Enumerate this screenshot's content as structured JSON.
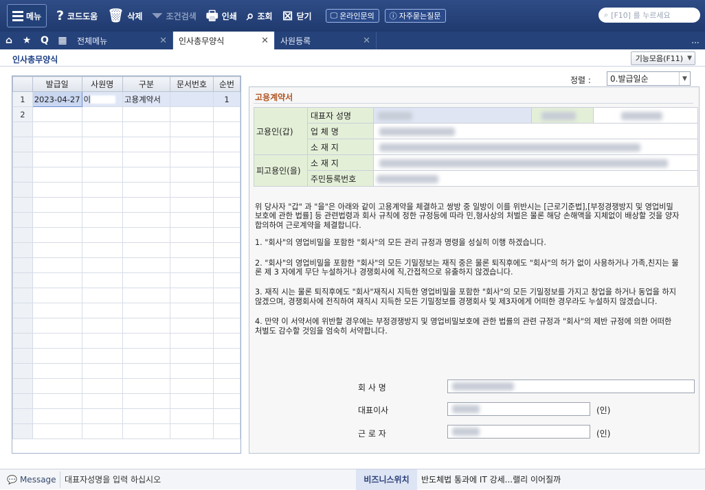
{
  "toolbar": {
    "menu_label": "메뉴",
    "code_help": "코드도움",
    "delete": "삭제",
    "condition_search": "조건검색",
    "print": "인쇄",
    "view": "조회",
    "close": "닫기",
    "online_inquiry": "온라인문의",
    "faq": "자주묻는질문",
    "search_placeholder": "[F10] 를 누르세요"
  },
  "tabs": {
    "all_menu": "전체메뉴",
    "hr_forms": "인사총무양식",
    "employee_reg": "사원등록",
    "more": "..."
  },
  "page": {
    "title": "인사총무양식",
    "func_button": "기능모음(F11)"
  },
  "grid": {
    "columns": [
      "발급일",
      "사원명",
      "구분",
      "문서번호",
      "순번"
    ],
    "rows": [
      {
        "num": "1",
        "date": "2023-04-27",
        "name": "이",
        "type": "고용계약서",
        "doc": "",
        "seq": "1"
      },
      {
        "num": "2",
        "date": "",
        "name": "",
        "type": "",
        "doc": "",
        "seq": ""
      }
    ]
  },
  "sort": {
    "label": "정렬 :",
    "value": "0.발급일순"
  },
  "contract": {
    "title": "고용계약서",
    "employer": "고용인(갑)",
    "employee": "피고용인(을)",
    "rep_name": "대표자 성명",
    "company": "업 체 명",
    "address": "소 재 지",
    "address2": "소 재 지",
    "resident_no": "주민등록번호",
    "para0": "위 당사자 \"갑\" 과 \"을\"은 아래와 같이 고용계약을 체결하고 쌍방 중 일방이 이를 위반시는 [근로기준법],[부정경쟁방지 및 영업비밀 보호에 관한 법률] 등 관련법령과 회사 규칙에 정한 규정등에 따라 민,형사상의 처벌은 물론 해당 손해액을 지체없이 배상할 것을 양자 합의하여 근로계약을 체결합니다.",
    "para1": "1. \"회사\"의 영업비밀을 포함한 \"회사\"의 모든 관리 규정과 명령을 성실히 이행 하겠습니다.",
    "para2": "2. \"회사\"의 영업비밀을 포함한 \"회사\"의 모든 기밀정보는 재직 중은 물론 퇴직후에도 \"회사\"의 허가 없이 사용하거나 가족,친지는 물론 제 3 자에게 무단 누설하거나 경쟁회사에 직,간접적으로 유출하지 않겠습니다.",
    "para3": "3. 재직 시는 물론 퇴직후에도 \"회사\"재직시 지득한 영업비밀을 포함한 \"회사\"의 모든 기밀정보를 가지고 창업을 하거나 동업을 하지 않겠으며, 경쟁회사에 전직하여 재직시 지득한 모든 기밀정보를 경쟁회사 및 제3자에게 어떠한 경우라도 누설하지 않겠습니다.",
    "para4": "4. 만약 이 서약서에 위반할 경우에는 부정경쟁방지 및 영업비밀보호에 관한 법률의 관련 규정과 \"회사\"의 제반 규정에 의한 어떠한 처벌도 감수할 것임을 엄숙히 서약합니다.",
    "sig_company": "회 사 명",
    "sig_ceo": "대표이사",
    "sig_worker": "근 로 자",
    "seal": "(인)"
  },
  "status": {
    "message_tag": "Message",
    "message": "대표자성명을 입력 하십시오",
    "news_tag": "비즈니스위치",
    "news": "반도체법  통과에 IT 강세...랠리 이어질까"
  }
}
